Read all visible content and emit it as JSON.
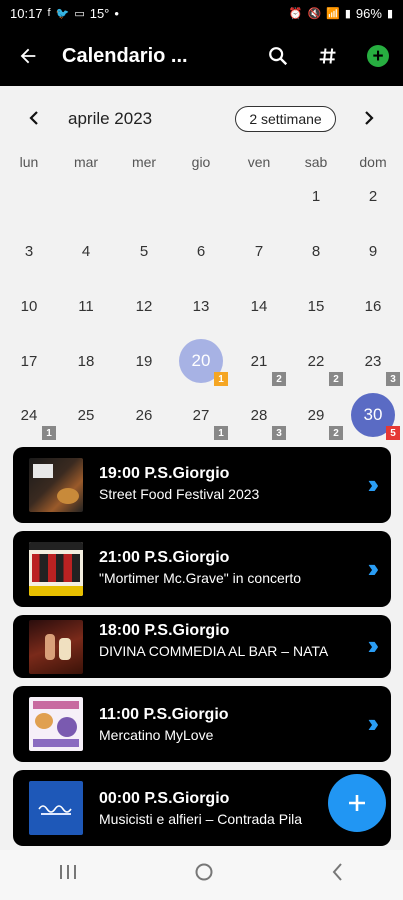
{
  "status": {
    "time": "10:17",
    "icons_left": [
      "facebook-icon",
      "twitter-icon",
      "message-icon"
    ],
    "temp": "15°",
    "dot": "•",
    "battery": "96%"
  },
  "appbar": {
    "title": "Calendario ..."
  },
  "calendar": {
    "month": "aprile 2023",
    "range_button": "2 settimane",
    "prev": "‹",
    "next": "›",
    "weekdays": [
      "lun",
      "mar",
      "mer",
      "gio",
      "ven",
      "sab",
      "dom"
    ],
    "weeks": [
      [
        "",
        "",
        "",
        "",
        "",
        "1",
        "2"
      ],
      [
        "3",
        "4",
        "5",
        "6",
        "7",
        "8",
        "9"
      ],
      [
        "10",
        "11",
        "12",
        "13",
        "14",
        "15",
        "16"
      ],
      [
        "17",
        "18",
        "19",
        "20",
        "21",
        "22",
        "23"
      ],
      [
        "24",
        "25",
        "26",
        "27",
        "28",
        "29",
        "30"
      ]
    ],
    "today": "20",
    "selected": "30",
    "badges": [
      {
        "day": "20",
        "count": "1",
        "color": "#f5a623"
      },
      {
        "day": "21",
        "count": "2",
        "color": "#888888"
      },
      {
        "day": "22",
        "count": "2",
        "color": "#888888"
      },
      {
        "day": "23",
        "count": "3",
        "color": "#888888"
      },
      {
        "day": "24",
        "count": "1",
        "color": "#888888"
      },
      {
        "day": "27",
        "count": "1",
        "color": "#888888"
      },
      {
        "day": "28",
        "count": "3",
        "color": "#888888"
      },
      {
        "day": "29",
        "count": "2",
        "color": "#888888"
      },
      {
        "day": "30",
        "count": "5",
        "color": "#e53935"
      }
    ]
  },
  "events": [
    {
      "time": "19:00 P.S.Giorgio",
      "title": "Street Food Festival 2023"
    },
    {
      "time": "21:00 P.S.Giorgio",
      "title": "\"Mortimer Mc.Grave\" in concerto"
    },
    {
      "time": "18:00 P.S.Giorgio",
      "title": "DIVINA COMMEDIA AL BAR – NATA"
    },
    {
      "time": "11:00 P.S.Giorgio",
      "title": "Mercatino MyLove"
    },
    {
      "time": "00:00 P.S.Giorgio",
      "title": "Musicisti e alfieri – Contrada Pila"
    }
  ],
  "colors": {
    "accent": "#2196f3",
    "today": "#a7b2e4",
    "selected": "#5a6bc4",
    "add": "#27ae40"
  }
}
